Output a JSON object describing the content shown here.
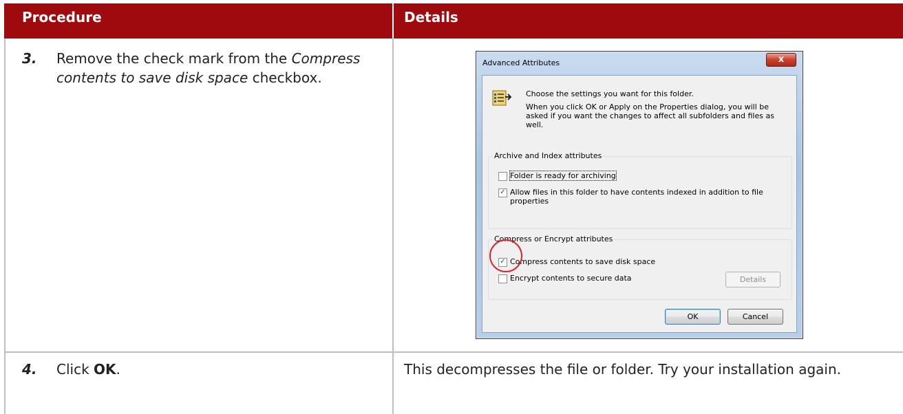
{
  "table": {
    "headers": [
      "Procedure",
      "Details"
    ],
    "rows": [
      {
        "number": "3.",
        "text_before": "Remove the check mark from the ",
        "text_em": "Compress contents to save disk space",
        "text_after": " checkbox."
      },
      {
        "number": "4.",
        "text_before": "Click ",
        "text_strong": "OK",
        "text_after": ".",
        "detail": "This decompresses the file or folder.  Try your installation again."
      }
    ]
  },
  "dialog": {
    "title": "Advanced Attributes",
    "close_label": "x",
    "intro_line1": "Choose the settings you want for this folder.",
    "intro_line2": "When you click OK or Apply on the Properties dialog, you will be asked if you want the changes to affect all subfolders and files as well.",
    "archive_group": {
      "label": "Archive and Index attributes",
      "checkboxes": [
        {
          "label": "Folder is ready for archiving",
          "checked": false
        },
        {
          "label": "Allow files in this folder to have contents indexed in addition to file properties",
          "checked": true
        }
      ]
    },
    "compress_group": {
      "label": "Compress or Encrypt attributes",
      "checkboxes": [
        {
          "label": "Compress contents to save disk space",
          "checked": true
        },
        {
          "label": "Encrypt contents to secure data",
          "checked": false
        }
      ],
      "details_button": "Details"
    },
    "ok_button": "OK",
    "cancel_button": "Cancel"
  },
  "colors": {
    "header_bg": "#9f0a0e",
    "highlight": "#e0242a"
  }
}
